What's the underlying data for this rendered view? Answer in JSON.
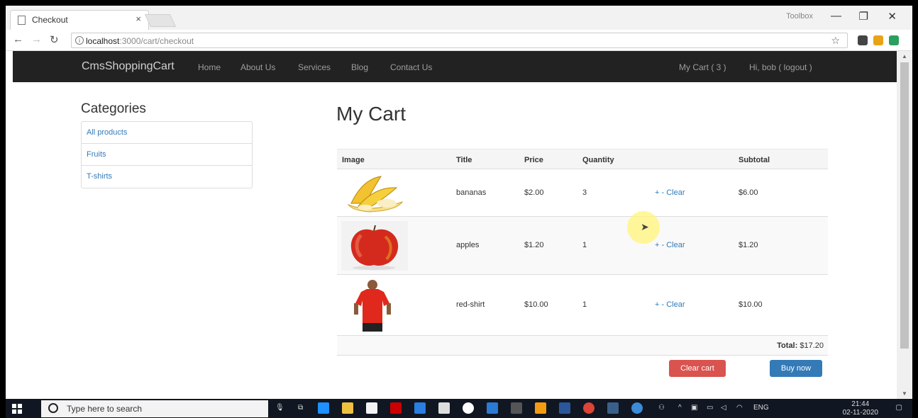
{
  "browser": {
    "tab_title": "Checkout",
    "tab_close": "×",
    "window_user": "Toolbox",
    "url_host": "localhost",
    "url_path": ":3000/cart/checkout"
  },
  "navbar": {
    "brand": "CmsShoppingCart",
    "links": [
      "Home",
      "About Us",
      "Services",
      "Blog",
      "Contact Us"
    ],
    "cart": "My Cart ( 3 )",
    "user": "Hi, bob ( logout )"
  },
  "categories": {
    "title": "Categories",
    "items": [
      "All products",
      "Fruits",
      "T-shirts"
    ]
  },
  "cart": {
    "title": "My Cart",
    "headers": {
      "image": "Image",
      "title": "Title",
      "price": "Price",
      "quantity": "Quantity",
      "subtotal": "Subtotal"
    },
    "rows": [
      {
        "image": "bananas-image",
        "title": "bananas",
        "price": "$2.00",
        "quantity": "3",
        "subtotal": "$6.00"
      },
      {
        "image": "apple-image",
        "title": "apples",
        "price": "$1.20",
        "quantity": "1",
        "subtotal": "$1.20"
      },
      {
        "image": "red-shirt-image",
        "title": "red-shirt",
        "price": "$10.00",
        "quantity": "1",
        "subtotal": "$10.00"
      }
    ],
    "actions": {
      "plus": "+",
      "minus": "-",
      "clear": "Clear"
    },
    "total_label": "Total:",
    "total_value": "$17.20",
    "clear_cart": "Clear cart",
    "buy_now": "Buy now"
  },
  "colors": {
    "navbar": "#222222",
    "link": "#337ab7",
    "clear_cart_button": "#d9534f",
    "buy_now_button": "#337ab7"
  },
  "taskbar": {
    "search_placeholder": "Type here to search",
    "language": "ENG",
    "time": "21:44",
    "date": "02-11-2020"
  }
}
